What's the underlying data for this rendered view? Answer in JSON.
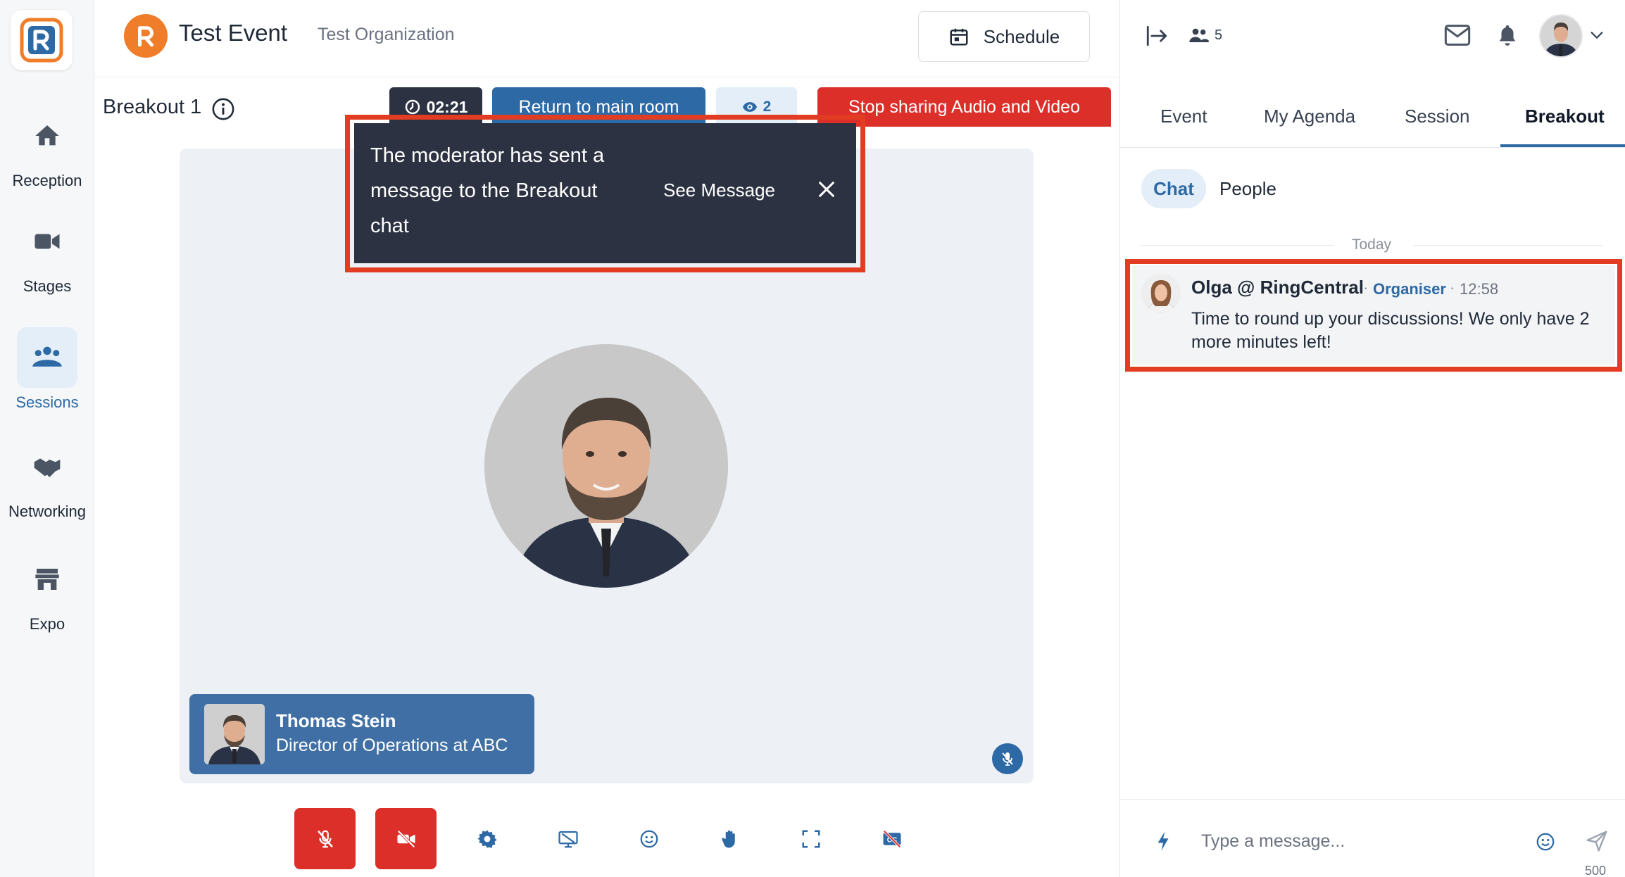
{
  "nav": {
    "items": [
      {
        "label": "Reception",
        "icon": "home-icon"
      },
      {
        "label": "Stages",
        "icon": "video-camera-icon"
      },
      {
        "label": "Sessions",
        "icon": "group-icon"
      },
      {
        "label": "Networking",
        "icon": "handshake-icon"
      },
      {
        "label": "Expo",
        "icon": "store-icon"
      }
    ],
    "active": "Sessions"
  },
  "header": {
    "event_title": "Test Event",
    "org_name": "Test Organization",
    "schedule_label": "Schedule"
  },
  "room": {
    "title": "Breakout 1",
    "timer": "02:21",
    "return_label": "Return to main room",
    "viewer_count": "2",
    "stop_sharing_label": "Stop sharing Audio and Video"
  },
  "toast": {
    "message": "The moderator has sent a message to the Breakout chat",
    "action_label": "See Message"
  },
  "participant": {
    "name": "Thomas Stein",
    "role": "Director of Operations at ABC"
  },
  "controls": [
    {
      "name": "mic-muted-button",
      "icon": "mic-off-icon"
    },
    {
      "name": "camera-off-button",
      "icon": "camera-off-icon"
    },
    {
      "name": "settings-button",
      "icon": "gear-icon"
    },
    {
      "name": "share-screen-button",
      "icon": "screen-share-icon"
    },
    {
      "name": "reactions-button",
      "icon": "smiley-icon"
    },
    {
      "name": "raise-hand-button",
      "icon": "hand-icon"
    },
    {
      "name": "fullscreen-button",
      "icon": "fullscreen-icon"
    },
    {
      "name": "captions-button",
      "icon": "captions-off-icon"
    }
  ],
  "right_panel": {
    "attendee_count": "5",
    "tabs": [
      "Event",
      "My Agenda",
      "Session",
      "Breakout"
    ],
    "active_tab": "Breakout",
    "subtabs": {
      "chat": "Chat",
      "people": "People"
    },
    "date_separator": "Today",
    "messages": [
      {
        "sender": "Olga @ RingCentral",
        "role": "Organiser",
        "time": "12:58",
        "text": "Time to round up your discussions! We only have 2 more minutes left!"
      }
    ],
    "composer": {
      "placeholder": "Type a message...",
      "char_limit": "500"
    }
  },
  "colors": {
    "brand_blue": "#2d6aa5",
    "danger_red": "#dc2f2a",
    "highlight_red": "#e23c23",
    "dark_toast": "#2c3242",
    "brand_orange": "#ef7d2a"
  }
}
